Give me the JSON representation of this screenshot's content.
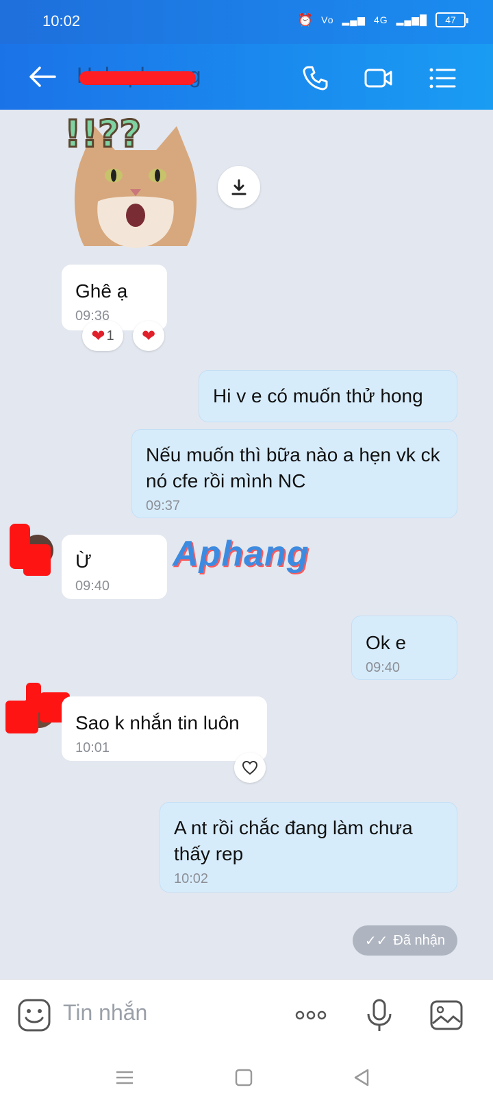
{
  "status_bar": {
    "time": "10:02",
    "network": "4G",
    "battery": "47"
  },
  "header": {
    "contact_name": "Hele phuong"
  },
  "messages": [
    {
      "side": "in",
      "text": "Ghê ạ",
      "time": "09:36"
    },
    {
      "side": "out",
      "text": "Hi v e có muốn thử hong",
      "time": ""
    },
    {
      "side": "out",
      "text": "Nếu muốn thì bữa nào a hẹn vk ck nó cfe rồi mình NC",
      "time": "09:37"
    },
    {
      "side": "in",
      "text": "Ừ",
      "time": "09:40"
    },
    {
      "side": "out",
      "text": "Ok e",
      "time": "09:40"
    },
    {
      "side": "in",
      "text": "Sao k nhắn tin luôn",
      "time": "10:01"
    },
    {
      "side": "out",
      "text": "A nt rồi chắc đang làm chưa thấy rep",
      "time": "10:02"
    }
  ],
  "reactions": {
    "count": "1"
  },
  "sticker": {
    "caption": "!!??"
  },
  "watermark": "Aphang",
  "delivery_status": "Đã nhận",
  "composer": {
    "placeholder": "Tin nhắn"
  },
  "colors": {
    "header": "#1b73e8",
    "outgoing_bubble": "#d7ecfb",
    "incoming_bubble": "#ffffff",
    "background": "#e3e7ef"
  }
}
